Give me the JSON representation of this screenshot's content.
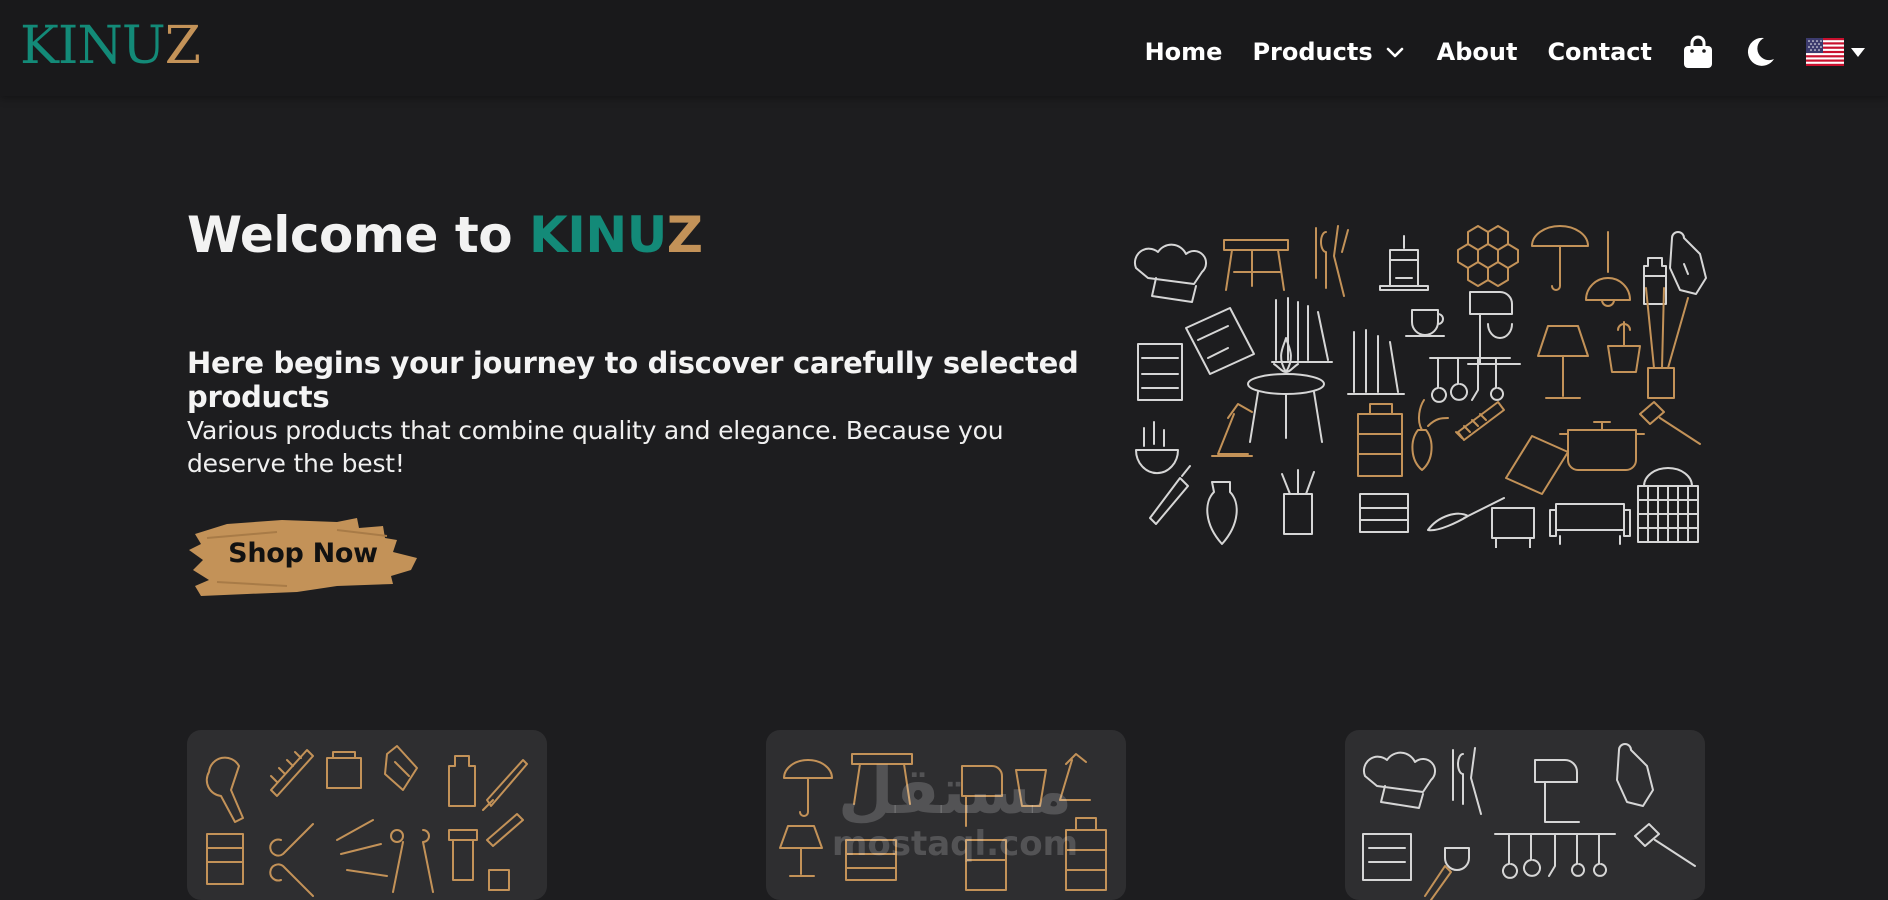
{
  "brand": {
    "logo_part_a": "KINU",
    "logo_part_b": "Z",
    "teal": "#138a78",
    "gold": "#c39258"
  },
  "nav": {
    "home": "Home",
    "products": "Products",
    "about": "About",
    "contact": "Contact",
    "icons": [
      "shopping-bag-icon",
      "moon-icon",
      "us-flag-icon",
      "caret-down-icon"
    ]
  },
  "hero": {
    "title_prefix": "Welcome to",
    "title_brand_a": "KINU",
    "title_brand_b": "Z",
    "subtitle": "Here begins your journey to discover carefully selected products",
    "description": "Various products that combine quality and elegance. Because you deserve the best!",
    "cta": "Shop Now"
  },
  "watermark": {
    "arabic": "مستقل",
    "latin": "mostaql.com"
  }
}
